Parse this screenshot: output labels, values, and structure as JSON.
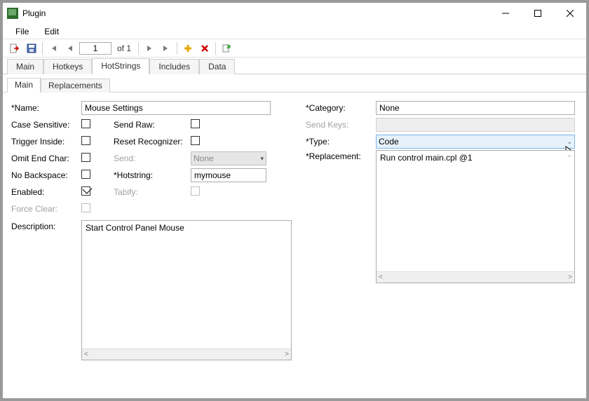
{
  "window": {
    "title": "Plugin"
  },
  "menu": {
    "file": "File",
    "edit": "Edit"
  },
  "nav": {
    "page_value": "1",
    "of_label": "of 1"
  },
  "outer_tabs": [
    "Main",
    "Hotkeys",
    "HotStrings",
    "Includes",
    "Data"
  ],
  "outer_active_index": 2,
  "inner_tabs": [
    "Main",
    "Replacements"
  ],
  "inner_active_index": 0,
  "labels": {
    "name": "*Name:",
    "case_sensitive": "Case Sensitive:",
    "send_raw": "Send Raw:",
    "trigger_inside": "Trigger Inside:",
    "reset_recognizer": "Reset Recognizer:",
    "omit_end_char": "Omit End Char:",
    "send": "Send:",
    "no_backspace": "No Backspace:",
    "hotstring": "*Hotstring:",
    "enabled": "Enabled:",
    "tabify": "Tabify:",
    "force_clear": "Force Clear:",
    "description": "Description:",
    "category": "*Category:",
    "send_keys": "Send Keys:",
    "type": "*Type:",
    "replacement": "*Replacement:"
  },
  "values": {
    "name": "Mouse Settings",
    "send_dropdown": "None",
    "hotstring": "mymouse",
    "description": "Start Control Panel Mouse",
    "category": "None",
    "type": "Code",
    "replacement": "Run control main.cpl @1"
  },
  "checks": {
    "case_sensitive": false,
    "send_raw": false,
    "trigger_inside": false,
    "reset_recognizer": false,
    "omit_end_char": false,
    "no_backspace": false,
    "enabled": true,
    "tabify": false,
    "force_clear": false
  }
}
